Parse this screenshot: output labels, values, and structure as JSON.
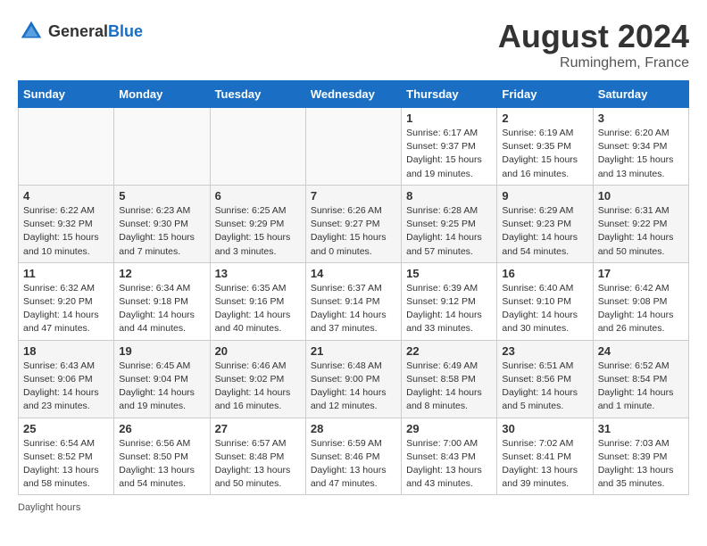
{
  "header": {
    "logo_general": "General",
    "logo_blue": "Blue",
    "month_title": "August 2024",
    "location": "Ruminghem, France"
  },
  "columns": [
    "Sunday",
    "Monday",
    "Tuesday",
    "Wednesday",
    "Thursday",
    "Friday",
    "Saturday"
  ],
  "weeks": [
    [
      {
        "day": "",
        "info": ""
      },
      {
        "day": "",
        "info": ""
      },
      {
        "day": "",
        "info": ""
      },
      {
        "day": "",
        "info": ""
      },
      {
        "day": "1",
        "info": "Sunrise: 6:17 AM\nSunset: 9:37 PM\nDaylight: 15 hours\nand 19 minutes."
      },
      {
        "day": "2",
        "info": "Sunrise: 6:19 AM\nSunset: 9:35 PM\nDaylight: 15 hours\nand 16 minutes."
      },
      {
        "day": "3",
        "info": "Sunrise: 6:20 AM\nSunset: 9:34 PM\nDaylight: 15 hours\nand 13 minutes."
      }
    ],
    [
      {
        "day": "4",
        "info": "Sunrise: 6:22 AM\nSunset: 9:32 PM\nDaylight: 15 hours\nand 10 minutes."
      },
      {
        "day": "5",
        "info": "Sunrise: 6:23 AM\nSunset: 9:30 PM\nDaylight: 15 hours\nand 7 minutes."
      },
      {
        "day": "6",
        "info": "Sunrise: 6:25 AM\nSunset: 9:29 PM\nDaylight: 15 hours\nand 3 minutes."
      },
      {
        "day": "7",
        "info": "Sunrise: 6:26 AM\nSunset: 9:27 PM\nDaylight: 15 hours\nand 0 minutes."
      },
      {
        "day": "8",
        "info": "Sunrise: 6:28 AM\nSunset: 9:25 PM\nDaylight: 14 hours\nand 57 minutes."
      },
      {
        "day": "9",
        "info": "Sunrise: 6:29 AM\nSunset: 9:23 PM\nDaylight: 14 hours\nand 54 minutes."
      },
      {
        "day": "10",
        "info": "Sunrise: 6:31 AM\nSunset: 9:22 PM\nDaylight: 14 hours\nand 50 minutes."
      }
    ],
    [
      {
        "day": "11",
        "info": "Sunrise: 6:32 AM\nSunset: 9:20 PM\nDaylight: 14 hours\nand 47 minutes."
      },
      {
        "day": "12",
        "info": "Sunrise: 6:34 AM\nSunset: 9:18 PM\nDaylight: 14 hours\nand 44 minutes."
      },
      {
        "day": "13",
        "info": "Sunrise: 6:35 AM\nSunset: 9:16 PM\nDaylight: 14 hours\nand 40 minutes."
      },
      {
        "day": "14",
        "info": "Sunrise: 6:37 AM\nSunset: 9:14 PM\nDaylight: 14 hours\nand 37 minutes."
      },
      {
        "day": "15",
        "info": "Sunrise: 6:39 AM\nSunset: 9:12 PM\nDaylight: 14 hours\nand 33 minutes."
      },
      {
        "day": "16",
        "info": "Sunrise: 6:40 AM\nSunset: 9:10 PM\nDaylight: 14 hours\nand 30 minutes."
      },
      {
        "day": "17",
        "info": "Sunrise: 6:42 AM\nSunset: 9:08 PM\nDaylight: 14 hours\nand 26 minutes."
      }
    ],
    [
      {
        "day": "18",
        "info": "Sunrise: 6:43 AM\nSunset: 9:06 PM\nDaylight: 14 hours\nand 23 minutes."
      },
      {
        "day": "19",
        "info": "Sunrise: 6:45 AM\nSunset: 9:04 PM\nDaylight: 14 hours\nand 19 minutes."
      },
      {
        "day": "20",
        "info": "Sunrise: 6:46 AM\nSunset: 9:02 PM\nDaylight: 14 hours\nand 16 minutes."
      },
      {
        "day": "21",
        "info": "Sunrise: 6:48 AM\nSunset: 9:00 PM\nDaylight: 14 hours\nand 12 minutes."
      },
      {
        "day": "22",
        "info": "Sunrise: 6:49 AM\nSunset: 8:58 PM\nDaylight: 14 hours\nand 8 minutes."
      },
      {
        "day": "23",
        "info": "Sunrise: 6:51 AM\nSunset: 8:56 PM\nDaylight: 14 hours\nand 5 minutes."
      },
      {
        "day": "24",
        "info": "Sunrise: 6:52 AM\nSunset: 8:54 PM\nDaylight: 14 hours\nand 1 minute."
      }
    ],
    [
      {
        "day": "25",
        "info": "Sunrise: 6:54 AM\nSunset: 8:52 PM\nDaylight: 13 hours\nand 58 minutes."
      },
      {
        "day": "26",
        "info": "Sunrise: 6:56 AM\nSunset: 8:50 PM\nDaylight: 13 hours\nand 54 minutes."
      },
      {
        "day": "27",
        "info": "Sunrise: 6:57 AM\nSunset: 8:48 PM\nDaylight: 13 hours\nand 50 minutes."
      },
      {
        "day": "28",
        "info": "Sunrise: 6:59 AM\nSunset: 8:46 PM\nDaylight: 13 hours\nand 47 minutes."
      },
      {
        "day": "29",
        "info": "Sunrise: 7:00 AM\nSunset: 8:43 PM\nDaylight: 13 hours\nand 43 minutes."
      },
      {
        "day": "30",
        "info": "Sunrise: 7:02 AM\nSunset: 8:41 PM\nDaylight: 13 hours\nand 39 minutes."
      },
      {
        "day": "31",
        "info": "Sunrise: 7:03 AM\nSunset: 8:39 PM\nDaylight: 13 hours\nand 35 minutes."
      }
    ]
  ],
  "footer": {
    "note": "Daylight hours"
  }
}
